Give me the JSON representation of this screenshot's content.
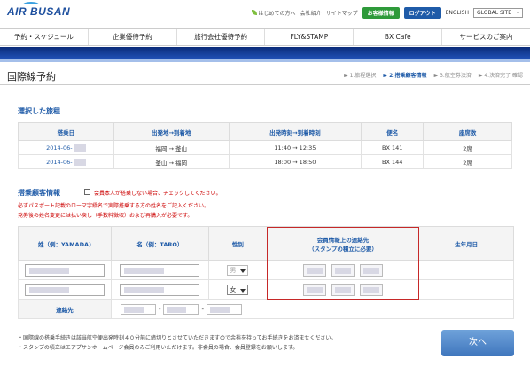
{
  "brand": {
    "logo_text": "AIR BUSAN",
    "accent": "#1f5ba8",
    "green": "#2e9a3a",
    "alert": "#c00000"
  },
  "top_links": {
    "beginner": "はじめての方へ",
    "company": "会社紹介",
    "sitemap": "サイトマップ",
    "member_info": "お客様情報",
    "logout": "ログアウト",
    "lang": "ENGLISH",
    "site_select": "GLOBAL SITE"
  },
  "nav": [
    "予約・スケジュール",
    "企業優待予約",
    "旅行会社優待予約",
    "FLY&STAMP",
    "BX Cafe",
    "サービスのご案内"
  ],
  "page": {
    "title": "国際線予約"
  },
  "steps": [
    "1.旅程選択",
    "2.搭乗顧客情報",
    "3.航空券決済",
    "4.決済完了 確認"
  ],
  "itinerary": {
    "title": "選択した旅程",
    "headers": [
      "搭乗日",
      "出発地→到着地",
      "出発時刻→到着時刻",
      "便名",
      "座席数"
    ],
    "rows": [
      {
        "date": "2014-06-",
        "route": "福岡 → 釜山",
        "time": "11:40 → 12:35",
        "flight": "BX 141",
        "seats": "2席"
      },
      {
        "date": "2014-06-",
        "route": "釜山 → 福岡",
        "time": "18:00 → 18:50",
        "flight": "BX 144",
        "seats": "2席"
      }
    ]
  },
  "passenger": {
    "title": "搭乗顧客情報",
    "check_label": "会員本人が搭乗しない場合、チェックしてください。",
    "notice_1": "必ずパスポート記載のローマ字綴名で実際搭乗する方の姓名をご記入ください。",
    "notice_2": "発券後の姓名変更には払い戻し（手数料徴収）および再購入が必要です。",
    "headers": {
      "last_name": "姓（例：YAMADA)",
      "first_name": "名（例：TARO）",
      "gender": "性別",
      "member_line1": "会員情報上の連絡先",
      "member_line2": "（スタンプの積立に必要）",
      "dob": "生年月日"
    },
    "genders": [
      "男",
      "女"
    ],
    "contact_label": "連絡先"
  },
  "footnotes": [
    "・国際線の搭乗手続きは該当航空便出発時刻４０分前に締切りとさせていただきますので余裕を持ってお手続きをお済ませください。",
    "・スタンプの積立はエアプサンホームページ会員のみご利用いただけます。非会員の場合、会員登録をお願いします。"
  ],
  "next_button": "次へ"
}
